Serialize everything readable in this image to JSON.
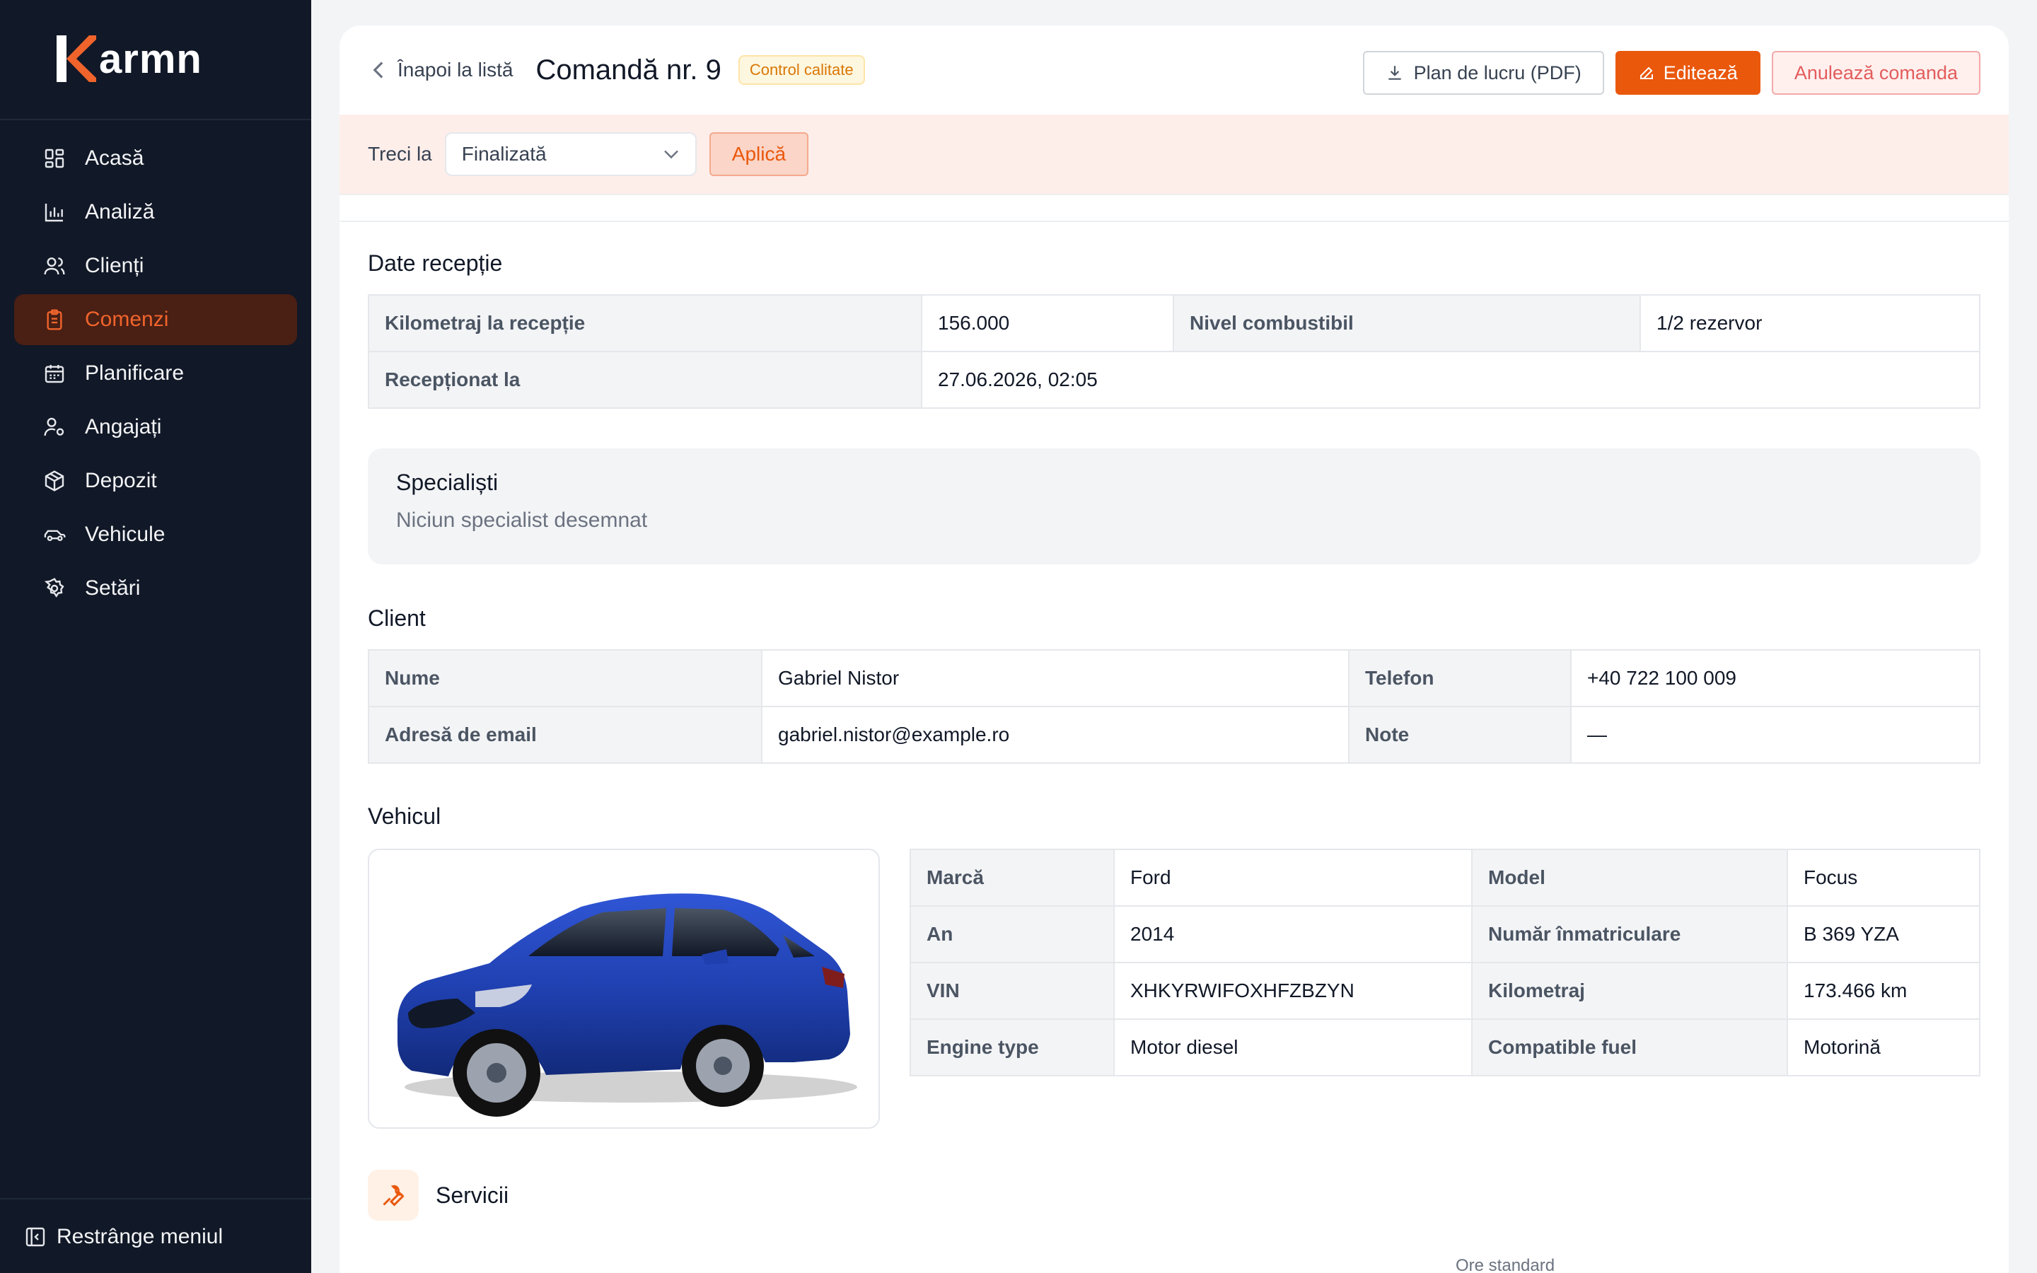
{
  "brand": {
    "name": "armn",
    "accent": "#f0642c"
  },
  "sidebar": {
    "items": [
      {
        "label": "Acasă",
        "icon": "dashboard-grid-icon"
      },
      {
        "label": "Analiză",
        "icon": "bar-chart-icon"
      },
      {
        "label": "Clienți",
        "icon": "users-icon"
      },
      {
        "label": "Comenzi",
        "icon": "clipboard-icon"
      },
      {
        "label": "Planificare",
        "icon": "calendar-icon"
      },
      {
        "label": "Angajați",
        "icon": "user-gear-icon"
      },
      {
        "label": "Depozit",
        "icon": "box-icon"
      },
      {
        "label": "Vehicule",
        "icon": "car-icon"
      },
      {
        "label": "Setări",
        "icon": "gear-icon"
      }
    ],
    "active_index": 3,
    "collapse_label": "Restrânge meniul"
  },
  "header": {
    "back_label": "Înapoi la listă",
    "title": "Comandă nr. 9",
    "status_badge": "Control calitate",
    "pdf_button": "Plan de lucru (PDF)",
    "edit_button": "Editează",
    "cancel_button": "Anulează comanda"
  },
  "status_bar": {
    "label": "Treci la",
    "selected": "Finalizată",
    "apply_button": "Aplică"
  },
  "reception": {
    "title": "Date recepție",
    "mileage_label": "Kilometraj la recepție",
    "mileage_value": "156.000",
    "fuel_label": "Nivel combustibil",
    "fuel_value": "1/2 rezervor",
    "received_label": "Recepționat la",
    "received_value": "27.06.2026, 02:05"
  },
  "specialists": {
    "title": "Specialiști",
    "empty_text": "Niciun specialist desemnat"
  },
  "client": {
    "title": "Client",
    "name_label": "Nume",
    "name_value": "Gabriel Nistor",
    "phone_label": "Telefon",
    "phone_value": "+40 722 100 009",
    "email_label": "Adresă de email",
    "email_value": "gabriel.nistor@example.ro",
    "notes_label": "Note",
    "notes_value": "—"
  },
  "vehicle": {
    "title": "Vehicul",
    "make_label": "Marcă",
    "make_value": "Ford",
    "model_label": "Model",
    "model_value": "Focus",
    "year_label": "An",
    "year_value": "2014",
    "plate_label": "Număr înmatriculare",
    "plate_value": "B 369 YZA",
    "vin_label": "VIN",
    "vin_value": "XHKYRWIFOXHFZBZYN",
    "km_label": "Kilometraj",
    "km_value": "173.466 km",
    "engine_label": "Engine type",
    "engine_value": "Motor diesel",
    "fuel_label": "Compatible fuel",
    "fuel_value": "Motorină",
    "car_color": "#1f3fae"
  },
  "services": {
    "title": "Servicii",
    "column_hint": "Ore standard"
  }
}
